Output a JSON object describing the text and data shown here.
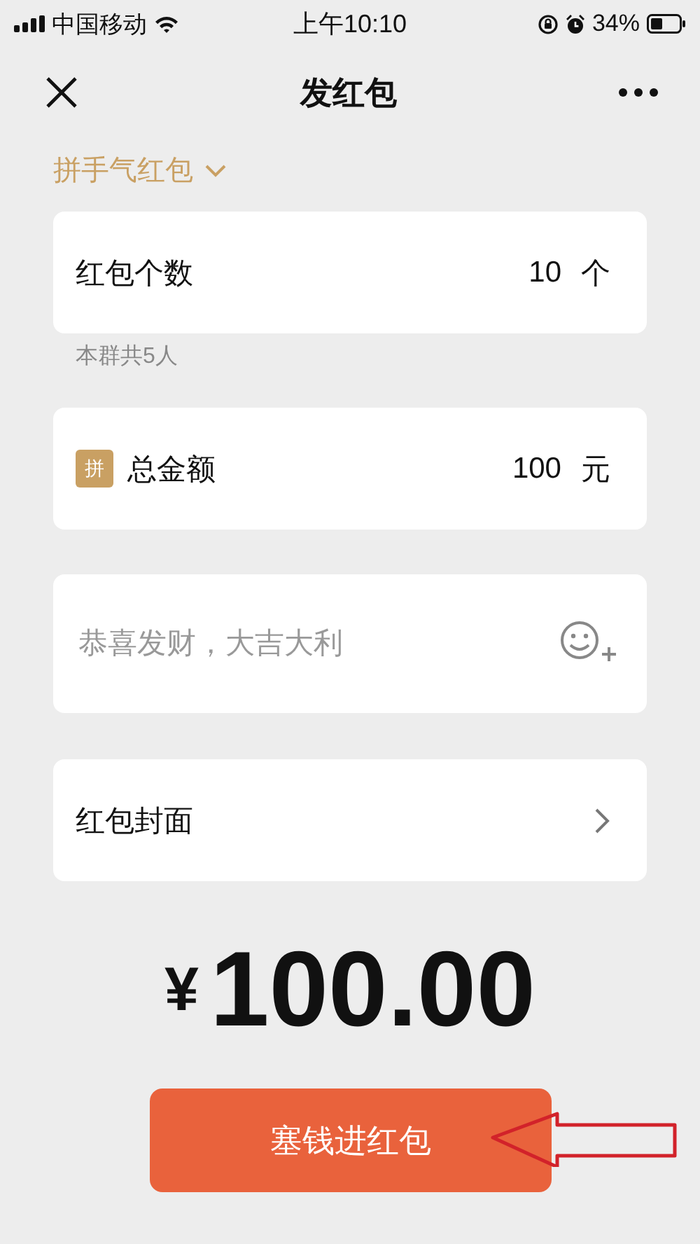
{
  "status_bar": {
    "carrier": "中国移动",
    "time": "上午10:10",
    "battery": "34%"
  },
  "nav": {
    "title": "发红包"
  },
  "packet_type": {
    "label": "拼手气红包"
  },
  "count_row": {
    "label": "红包个数",
    "value": "10",
    "unit": "个"
  },
  "group_note": "本群共5人",
  "amount_row": {
    "badge": "拼",
    "label": "总金额",
    "value": "100",
    "unit": "元"
  },
  "greeting": {
    "placeholder": "恭喜发财，大吉大利"
  },
  "cover_row": {
    "label": "红包封面"
  },
  "total": {
    "currency": "¥",
    "amount": "100.00"
  },
  "submit_button": {
    "label": "塞钱进红包"
  }
}
